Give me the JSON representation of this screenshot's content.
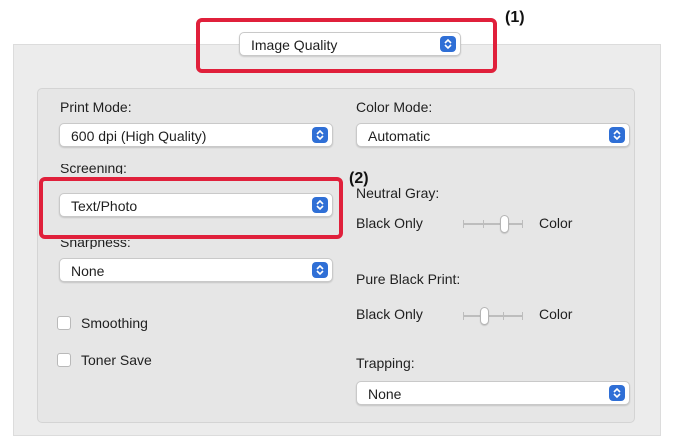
{
  "header": {
    "panel_selector": "Image Quality"
  },
  "left_column": {
    "print_mode_label": "Print Mode:",
    "print_mode_value": "600 dpi (High Quality)",
    "screening_label": "Screening:",
    "screening_value": "Text/Photo",
    "sharpness_label": "Sharpness:",
    "sharpness_value": "None",
    "smoothing_label": "Smoothing",
    "toner_save_label": "Toner Save"
  },
  "right_column": {
    "color_mode_label": "Color Mode:",
    "color_mode_value": "Automatic",
    "neutral_gray_label": "Neutral Gray:",
    "neutral_gray_left": "Black Only",
    "neutral_gray_right": "Color",
    "pure_black_label": "Pure Black Print:",
    "pure_black_left": "Black Only",
    "pure_black_right": "Color",
    "trapping_label": "Trapping:",
    "trapping_value": "None"
  },
  "annotations": {
    "callout_1": "(1)",
    "callout_2": "(2)"
  },
  "colors": {
    "accent": "#2f6fd6",
    "highlight": "#e0203b"
  }
}
